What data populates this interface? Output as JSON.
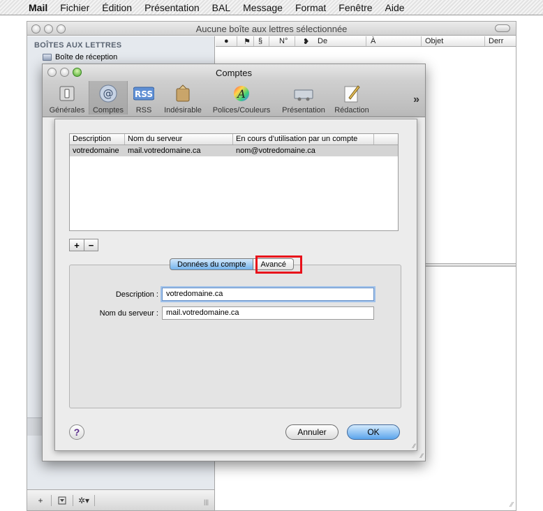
{
  "menubar": {
    "apple": "",
    "items": [
      "Mail",
      "Fichier",
      "Édition",
      "Présentation",
      "BAL",
      "Message",
      "Format",
      "Fenêtre",
      "Aide"
    ]
  },
  "mail_window": {
    "title": "Aucune boîte aux lettres sélectionnée",
    "sidebar_heading": "BOÎTES AUX LETTRES",
    "inbox_label": "Boîte de réception",
    "columns": [
      "●",
      "⚑",
      "§",
      "N°",
      "❥",
      "De",
      "À",
      "Objet",
      "Derr"
    ]
  },
  "prefs_window": {
    "title": "Comptes",
    "toolbar": [
      {
        "label": "Générales",
        "icon": "switch-icon"
      },
      {
        "label": "Comptes",
        "icon": "at-sign-icon"
      },
      {
        "label": "RSS",
        "icon": "rss-icon"
      },
      {
        "label": "Indésirable",
        "icon": "junk-icon"
      },
      {
        "label": "Polices/Couleurs",
        "icon": "fonts-colors-icon"
      },
      {
        "label": "Présentation",
        "icon": "presentation-icon"
      },
      {
        "label": "Rédaction",
        "icon": "compose-icon"
      }
    ],
    "more": "»"
  },
  "accounts_table": {
    "headers": [
      "Description",
      "Nom du serveur",
      "En cours d’utilisation par un compte"
    ],
    "rows": [
      [
        "votredomaine",
        "mail.votredomaine.ca",
        "nom@votredomaine.ca"
      ]
    ]
  },
  "tabs": {
    "account_data": "Données du compte",
    "advanced": "Avancé"
  },
  "form": {
    "description_label": "Description :",
    "description_value": "votredomaine.ca",
    "server_label": "Nom du serveur :",
    "server_value": "mail.votredomaine.ca"
  },
  "buttons": {
    "add": "+",
    "remove": "−",
    "help": "?",
    "cancel": "Annuler",
    "ok": "OK"
  },
  "accent": {
    "selection": "#d4d4d4",
    "highlight": "#e8101a",
    "ok_button": "#5aa4ec"
  }
}
